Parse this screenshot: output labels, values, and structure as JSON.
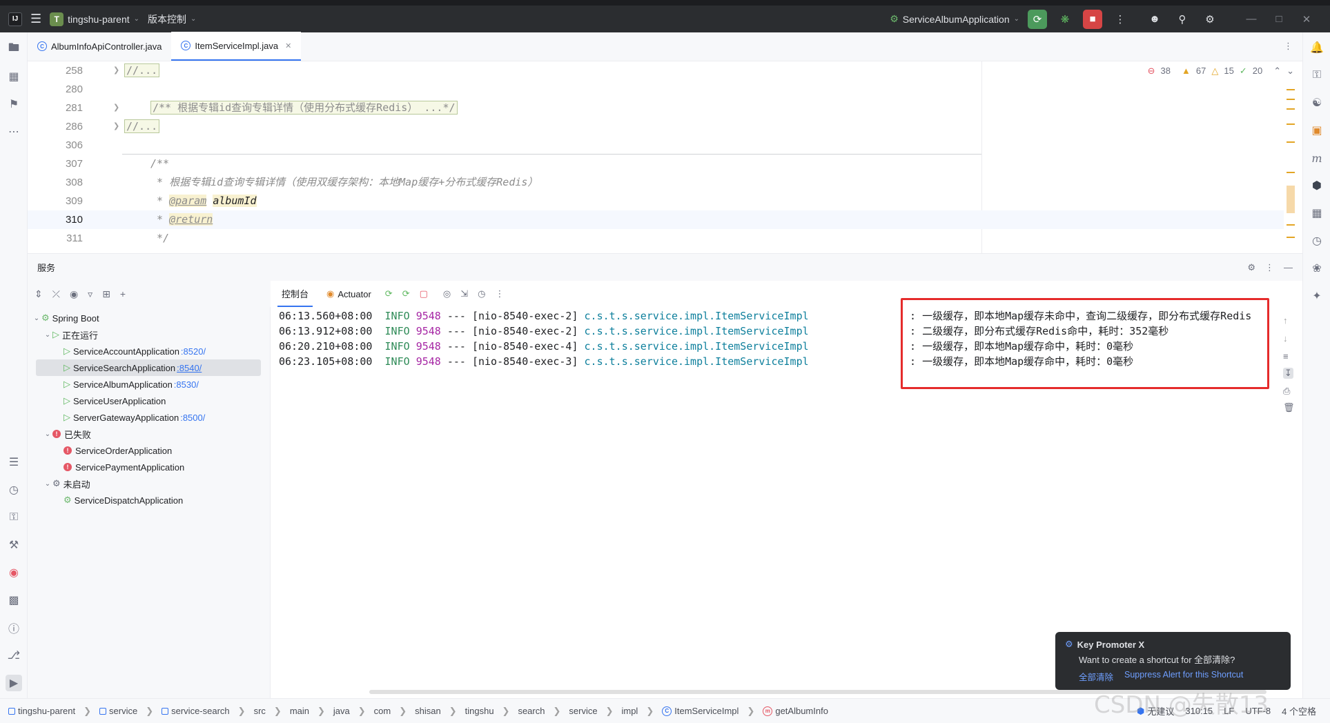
{
  "titlebar": {
    "project_badge": "T",
    "project_name": "tingshu-parent",
    "vcs_label": "版本控制",
    "run_config": "ServiceAlbumApplication"
  },
  "tabs": [
    {
      "label": "AlbumInfoApiController.java",
      "active": false
    },
    {
      "label": "ItemServiceImpl.java",
      "active": true
    }
  ],
  "editor": {
    "inspections": {
      "errors": "38",
      "warnings": "67",
      "weak_warnings": "15",
      "ok": "20"
    },
    "lines": [
      {
        "num": "258",
        "fold": true
      },
      {
        "num": "280",
        "fold": false
      },
      {
        "num": "281",
        "fold": true
      },
      {
        "num": "286",
        "fold": true
      },
      {
        "num": "306",
        "fold": false
      },
      {
        "num": "307",
        "fold": false
      },
      {
        "num": "308",
        "fold": false
      },
      {
        "num": "309",
        "fold": false
      },
      {
        "num": "310",
        "fold": false
      },
      {
        "num": "311",
        "fold": false
      }
    ],
    "code": {
      "l258": "//...",
      "l281": "/** 根据专辑id查询专辑详情（使用分布式缓存Redis） ...*/",
      "l286": "//...",
      "l307": "/**",
      "l308": " * 根据专辑id查询专辑详情（使用双缓存架构：本地Map缓存+分布式缓存Redis）",
      "l309_prefix": " * ",
      "l309_tag": "@param",
      "l309_param": "albumId",
      "l310_prefix": " * ",
      "l310_tag": "@return",
      "l311": " */"
    }
  },
  "services": {
    "title": "服务",
    "tree": {
      "root": "Spring Boot",
      "running_group": "正在运行",
      "running": [
        {
          "name": "ServiceAccountApplication",
          "port": ":8520/"
        },
        {
          "name": "ServiceSearchApplication",
          "port": ":8540/"
        },
        {
          "name": "ServiceAlbumApplication",
          "port": ":8530/"
        },
        {
          "name": "ServiceUserApplication",
          "port": ""
        },
        {
          "name": "ServerGatewayApplication",
          "port": ":8500/"
        }
      ],
      "failed_group": "已失败",
      "failed": [
        {
          "name": "ServiceOrderApplication"
        },
        {
          "name": "ServicePaymentApplication"
        }
      ],
      "not_started_group": "未启动",
      "not_started": [
        {
          "name": "ServiceDispatchApplication"
        }
      ]
    }
  },
  "console": {
    "tab_console": "控制台",
    "tab_actuator": "Actuator",
    "logs": [
      {
        "time": "06:13.560+08:00",
        "level": "INFO",
        "pid": "9548",
        "sep": "---",
        "thread": "[nio-8540-exec-2]",
        "cls": "c.s.t.s.service.impl.ItemServiceImpl",
        "msg": "一级缓存，即本地Map缓存未命中，查询二级缓存，即分布式缓存Redis"
      },
      {
        "time": "06:13.912+08:00",
        "level": "INFO",
        "pid": "9548",
        "sep": "---",
        "thread": "[nio-8540-exec-2]",
        "cls": "c.s.t.s.service.impl.ItemServiceImpl",
        "msg": "二级缓存，即分布式缓存Redis命中，耗时：352毫秒"
      },
      {
        "time": "06:20.210+08:00",
        "level": "INFO",
        "pid": "9548",
        "sep": "---",
        "thread": "[nio-8540-exec-4]",
        "cls": "c.s.t.s.service.impl.ItemServiceImpl",
        "msg": "一级缓存，即本地Map缓存命中，耗时：0毫秒"
      },
      {
        "time": "06:23.105+08:00",
        "level": "INFO",
        "pid": "9548",
        "sep": "---",
        "thread": "[nio-8540-exec-3]",
        "cls": "c.s.t.s.service.impl.ItemServiceImpl",
        "msg": "一级缓存，即本地Map缓存命中，耗时：0毫秒"
      }
    ]
  },
  "popup": {
    "title": "Key Promoter X",
    "message": "Want to create a shortcut for 全部清除?",
    "link_clear": "全部清除",
    "link_suppress": "Suppress Alert for this Shortcut"
  },
  "statusbar": {
    "breadcrumbs": [
      "tingshu-parent",
      "service",
      "service-search",
      "src",
      "main",
      "java",
      "com",
      "shisan",
      "tingshu",
      "search",
      "service",
      "impl",
      "ItemServiceImpl",
      "getAlbumInfo"
    ],
    "advice": "无建议",
    "position": "310:15",
    "line_sep": "LF",
    "encoding": "UTF-8",
    "indent": "4 个空格"
  },
  "watermark": "CSDN @失散13"
}
